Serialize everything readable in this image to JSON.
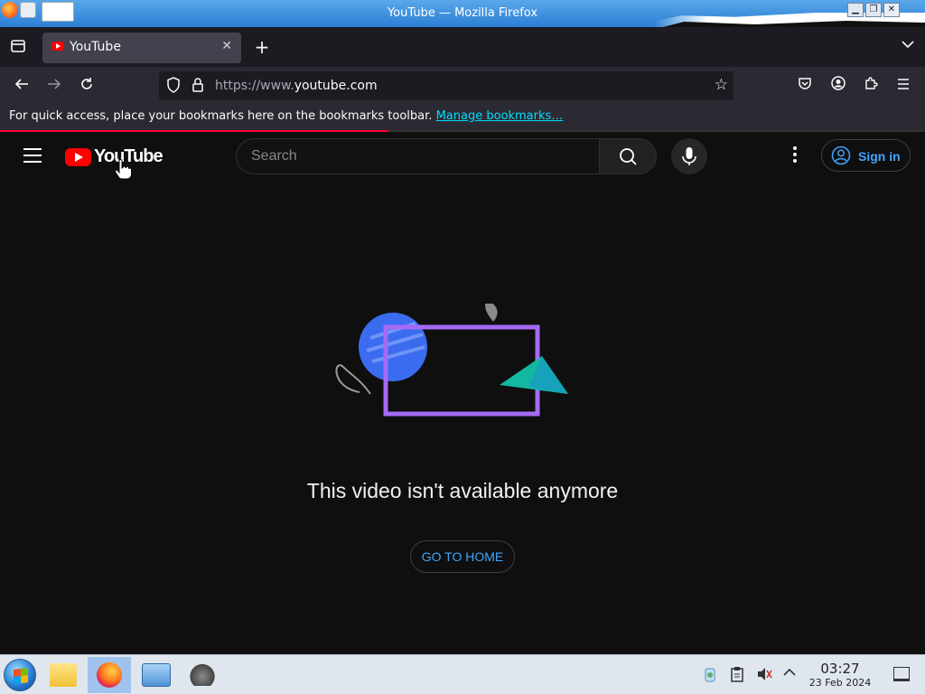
{
  "window": {
    "title": "YouTube — Mozilla Firefox"
  },
  "tabs": [
    {
      "label": "YouTube",
      "active": true
    }
  ],
  "navbar": {
    "url_prefix": "https://www.",
    "url_domain": "youtube.com"
  },
  "bookmarks_bar": {
    "message": "For quick access, place your bookmarks here on the bookmarks toolbar. ",
    "link": "Manage bookmarks…"
  },
  "page_load_progress": 0.42,
  "youtube": {
    "logo_text": "YouTube",
    "search_placeholder": "Search",
    "signin_label": "Sign in",
    "message": "This video isn't available anymore",
    "go_home_label": "GO TO HOME"
  },
  "taskbar": {
    "time": "03:27",
    "date": "23 Feb 2024",
    "apps": [
      "start-menu",
      "file-manager",
      "firefox",
      "control-panel",
      "gimp"
    ],
    "active_app": "firefox"
  },
  "colors": {
    "yt_red": "#ff0000",
    "link_blue": "#3ea6ff",
    "firefox_link": "#00ddff",
    "illus_blue": "#3b6cf0",
    "illus_purple": "#a66af5",
    "illus_teal": "#12b8a0"
  }
}
